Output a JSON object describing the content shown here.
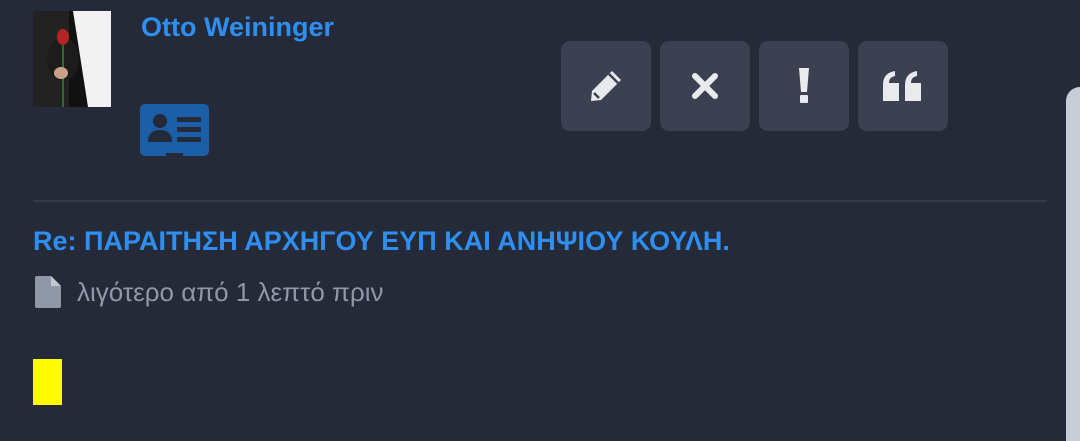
{
  "post": {
    "author": "Otto Weininger",
    "title": "Re: ΠΑΡΑΙΤΗΣΗ ΑΡΧΗΓΟΥ ΕΥΠ ΚΑΙ ΑΝΗΨΙΟΥ ΚΟΥΛΗ.",
    "timestamp": "λιγότερο από 1 λεπτό πριν"
  },
  "icons": {
    "profile_card": "id-card-icon",
    "edit": "pencil-icon",
    "delete": "close-icon",
    "report": "exclamation-icon",
    "quote": "quote-icon",
    "post_type": "document-icon"
  },
  "colors": {
    "background": "#242a38",
    "accent": "#2f8ef2",
    "button": "#3b4150",
    "highlight": "#fffb00"
  }
}
